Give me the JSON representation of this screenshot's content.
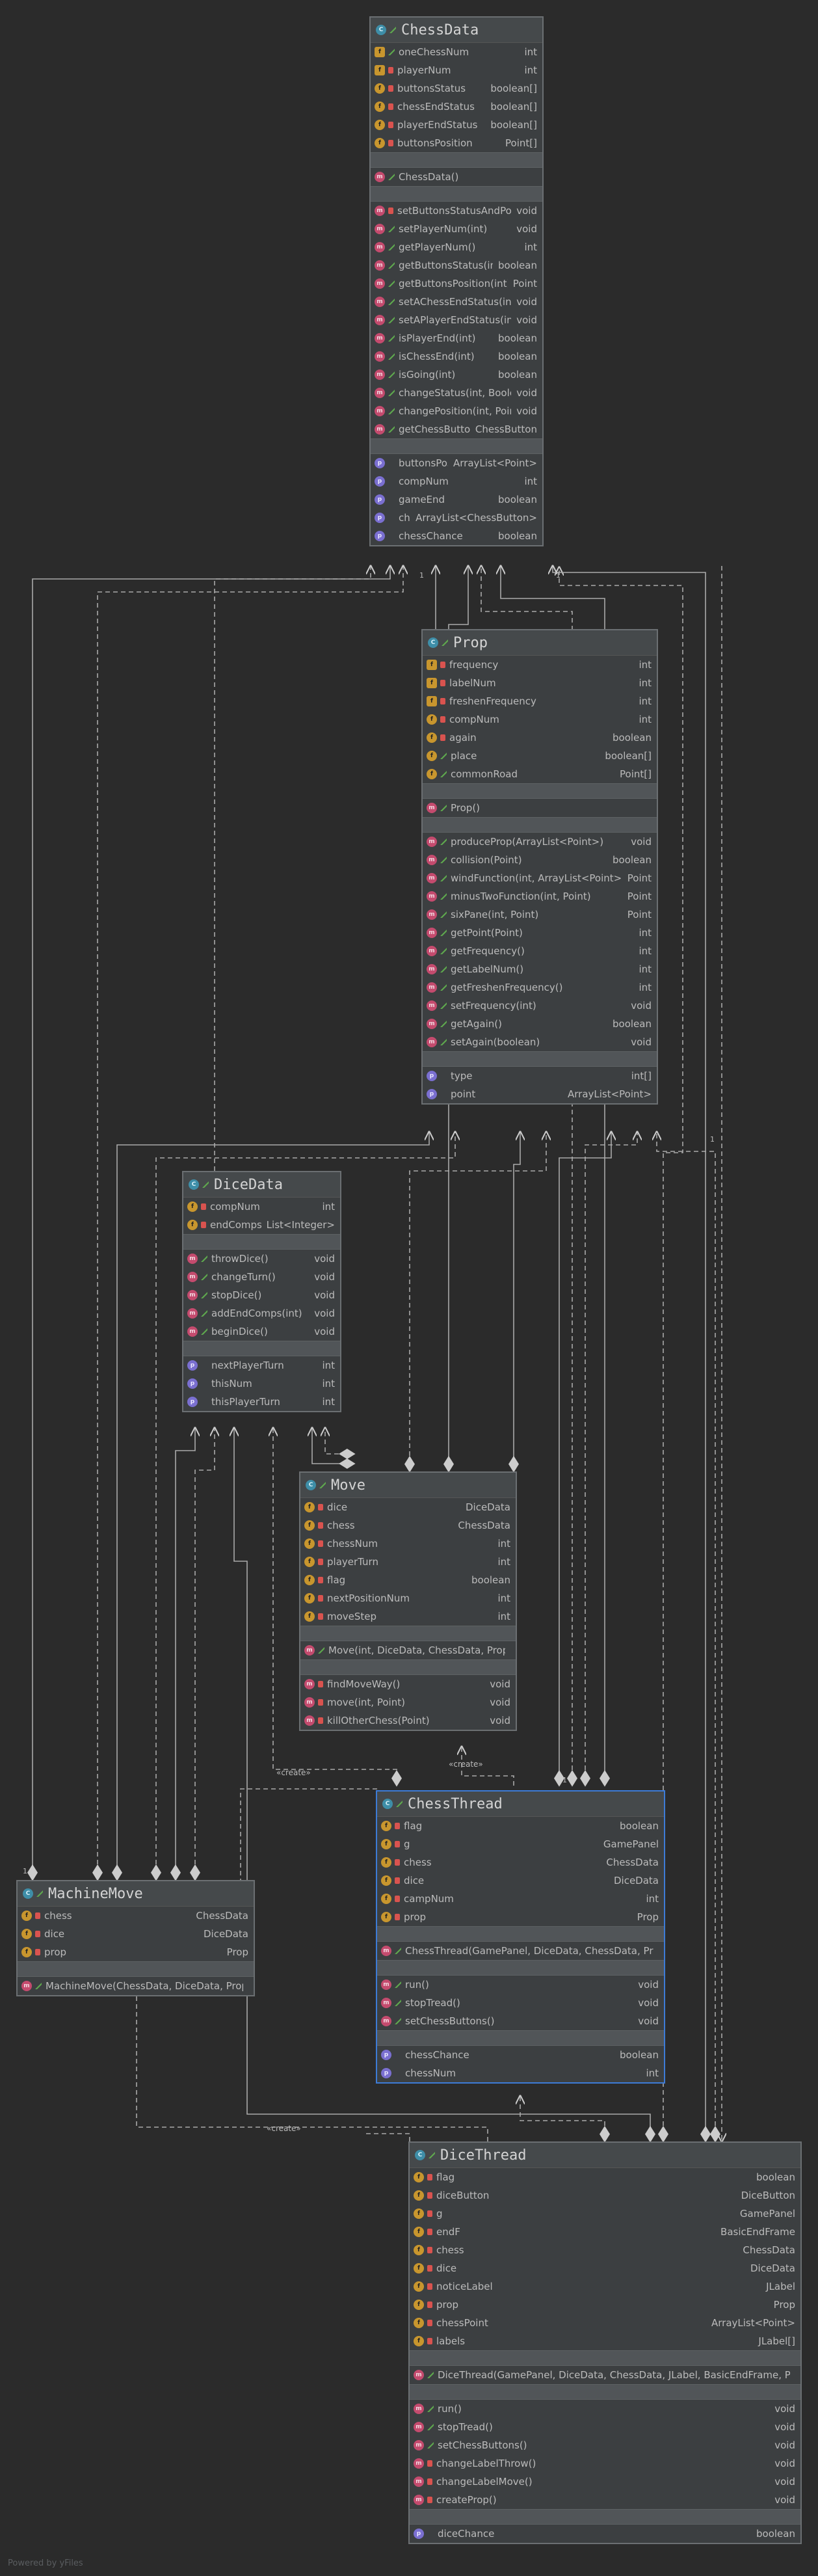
{
  "classes": [
    {
      "id": "chessdata",
      "title": "ChessData",
      "fields": [
        {
          "n": "oneChessNum",
          "t": "int",
          "icon": "fs",
          "vis": "pub"
        },
        {
          "n": "playerNum",
          "t": "int",
          "icon": "fs",
          "vis": "pri"
        },
        {
          "n": "buttonsStatus",
          "t": "boolean[]",
          "icon": "f",
          "vis": "pri"
        },
        {
          "n": "chessEndStatus",
          "t": "boolean[]",
          "icon": "f",
          "vis": "pri"
        },
        {
          "n": "playerEndStatus",
          "t": "boolean[]",
          "icon": "f",
          "vis": "pri"
        },
        {
          "n": "buttonsPosition",
          "t": "Point[]",
          "icon": "f",
          "vis": "pri"
        }
      ],
      "ctors": [
        {
          "n": "ChessData()",
          "t": "",
          "icon": "m",
          "vis": "pub"
        }
      ],
      "methods": [
        {
          "n": "setButtonsStatusAndPosition()",
          "t": "void",
          "icon": "m",
          "vis": "pri"
        },
        {
          "n": "setPlayerNum(int)",
          "t": "void",
          "icon": "m",
          "vis": "pub"
        },
        {
          "n": "getPlayerNum()",
          "t": "int",
          "icon": "m",
          "vis": "pub"
        },
        {
          "n": "getButtonsStatus(int)",
          "t": "boolean",
          "icon": "m",
          "vis": "pub"
        },
        {
          "n": "getButtonsPosition(int)",
          "t": "Point",
          "icon": "m",
          "vis": "pub"
        },
        {
          "n": "setAChessEndStatus(int, boolean)",
          "t": "void",
          "icon": "m",
          "vis": "pub"
        },
        {
          "n": "setAPlayerEndStatus(int, boolean)",
          "t": "void",
          "icon": "m",
          "vis": "pub"
        },
        {
          "n": "isPlayerEnd(int)",
          "t": "boolean",
          "icon": "m",
          "vis": "pub"
        },
        {
          "n": "isChessEnd(int)",
          "t": "boolean",
          "icon": "m",
          "vis": "pub"
        },
        {
          "n": "isGoing(int)",
          "t": "boolean",
          "icon": "m",
          "vis": "pub"
        },
        {
          "n": "changeStatus(int, Boolean)",
          "t": "void",
          "icon": "m",
          "vis": "pub"
        },
        {
          "n": "changePosition(int, Point)",
          "t": "void",
          "icon": "m",
          "vis": "pub"
        },
        {
          "n": "getChessButton(int)",
          "t": "ChessButton",
          "icon": "m",
          "vis": "pub"
        }
      ],
      "props": [
        {
          "n": "buttonsPosition",
          "t": "ArrayList<Point>",
          "icon": "p",
          "vis": "none"
        },
        {
          "n": "compNum",
          "t": "int",
          "icon": "p",
          "vis": "none"
        },
        {
          "n": "gameEnd",
          "t": "boolean",
          "icon": "p",
          "vis": "none"
        },
        {
          "n": "chessButtons",
          "t": "ArrayList<ChessButton>",
          "icon": "p",
          "vis": "none"
        },
        {
          "n": "chessChance",
          "t": "boolean",
          "icon": "p",
          "vis": "none"
        }
      ]
    },
    {
      "id": "prop",
      "title": "Prop",
      "fields": [
        {
          "n": "frequency",
          "t": "int",
          "icon": "fs",
          "vis": "pri"
        },
        {
          "n": "labelNum",
          "t": "int",
          "icon": "fs",
          "vis": "pri"
        },
        {
          "n": "freshenFrequency",
          "t": "int",
          "icon": "fs",
          "vis": "pri"
        },
        {
          "n": "compNum",
          "t": "int",
          "icon": "f",
          "vis": "pri"
        },
        {
          "n": "again",
          "t": "boolean",
          "icon": "f",
          "vis": "pri"
        },
        {
          "n": "place",
          "t": "boolean[]",
          "icon": "f",
          "vis": "pub"
        },
        {
          "n": "commonRoad",
          "t": "Point[]",
          "icon": "f",
          "vis": "pub"
        }
      ],
      "ctors": [
        {
          "n": "Prop()",
          "t": "",
          "icon": "m",
          "vis": "pub"
        }
      ],
      "methods": [
        {
          "n": "produceProp(ArrayList<Point>)",
          "t": "void",
          "icon": "m",
          "vis": "pub"
        },
        {
          "n": "collision(Point)",
          "t": "boolean",
          "icon": "m",
          "vis": "pub"
        },
        {
          "n": "windFunction(int, ArrayList<Point>)",
          "t": "Point",
          "icon": "m",
          "vis": "pub"
        },
        {
          "n": "minusTwoFunction(int, Point)",
          "t": "Point",
          "icon": "m",
          "vis": "pub"
        },
        {
          "n": "sixPane(int, Point)",
          "t": "Point",
          "icon": "m",
          "vis": "pub"
        },
        {
          "n": "getPoint(Point)",
          "t": "int",
          "icon": "m",
          "vis": "pub"
        },
        {
          "n": "getFrequency()",
          "t": "int",
          "icon": "m",
          "vis": "pub"
        },
        {
          "n": "getLabelNum()",
          "t": "int",
          "icon": "m",
          "vis": "pub"
        },
        {
          "n": "getFreshenFrequency()",
          "t": "int",
          "icon": "m",
          "vis": "pub"
        },
        {
          "n": "setFrequency(int)",
          "t": "void",
          "icon": "m",
          "vis": "pub"
        },
        {
          "n": "getAgain()",
          "t": "boolean",
          "icon": "m",
          "vis": "pub"
        },
        {
          "n": "setAgain(boolean)",
          "t": "void",
          "icon": "m",
          "vis": "pub"
        }
      ],
      "props": [
        {
          "n": "type",
          "t": "int[]",
          "icon": "p",
          "vis": "none"
        },
        {
          "n": "point",
          "t": "ArrayList<Point>",
          "icon": "p",
          "vis": "none"
        }
      ]
    },
    {
      "id": "dicedata",
      "title": "DiceData",
      "fields": [
        {
          "n": "compNum",
          "t": "int",
          "icon": "f",
          "vis": "pri"
        },
        {
          "n": "endComps",
          "t": "List<Integer>",
          "icon": "f",
          "vis": "pri"
        }
      ],
      "ctors": [],
      "methods": [
        {
          "n": "throwDice()",
          "t": "void",
          "icon": "m",
          "vis": "pub"
        },
        {
          "n": "changeTurn()",
          "t": "void",
          "icon": "m",
          "vis": "pub"
        },
        {
          "n": "stopDice()",
          "t": "void",
          "icon": "m",
          "vis": "pub"
        },
        {
          "n": "addEndComps(int)",
          "t": "void",
          "icon": "m",
          "vis": "pub"
        },
        {
          "n": "beginDice()",
          "t": "void",
          "icon": "m",
          "vis": "pub"
        }
      ],
      "props": [
        {
          "n": "nextPlayerTurn",
          "t": "int",
          "icon": "p",
          "vis": "none"
        },
        {
          "n": "thisNum",
          "t": "int",
          "icon": "p",
          "vis": "none"
        },
        {
          "n": "thisPlayerTurn",
          "t": "int",
          "icon": "p",
          "vis": "none"
        }
      ]
    },
    {
      "id": "move",
      "title": "Move",
      "fields": [
        {
          "n": "dice",
          "t": "DiceData",
          "icon": "f",
          "vis": "pri"
        },
        {
          "n": "chess",
          "t": "ChessData",
          "icon": "f",
          "vis": "pri"
        },
        {
          "n": "chessNum",
          "t": "int",
          "icon": "f",
          "vis": "pri"
        },
        {
          "n": "playerTurn",
          "t": "int",
          "icon": "f",
          "vis": "pri"
        },
        {
          "n": "flag",
          "t": "boolean",
          "icon": "f",
          "vis": "pri"
        },
        {
          "n": "nextPositionNum",
          "t": "int",
          "icon": "f",
          "vis": "pri"
        },
        {
          "n": "moveStep",
          "t": "int",
          "icon": "f",
          "vis": "pri"
        }
      ],
      "ctors": [
        {
          "n": "Move(int, DiceData, ChessData, Prop)",
          "t": "",
          "icon": "m",
          "vis": "pub"
        }
      ],
      "methods": [
        {
          "n": "findMoveWay()",
          "t": "void",
          "icon": "m",
          "vis": "pri"
        },
        {
          "n": "move(int, Point)",
          "t": "void",
          "icon": "m",
          "vis": "pri"
        },
        {
          "n": "killOtherChess(Point)",
          "t": "void",
          "icon": "m",
          "vis": "pri"
        }
      ],
      "props": []
    },
    {
      "id": "chessthread",
      "title": "ChessThread",
      "fields": [
        {
          "n": "flag",
          "t": "boolean",
          "icon": "f",
          "vis": "pri"
        },
        {
          "n": "g",
          "t": "GamePanel",
          "icon": "f",
          "vis": "pri"
        },
        {
          "n": "chess",
          "t": "ChessData",
          "icon": "f",
          "vis": "pri"
        },
        {
          "n": "dice",
          "t": "DiceData",
          "icon": "f",
          "vis": "pri"
        },
        {
          "n": "campNum",
          "t": "int",
          "icon": "f",
          "vis": "pri"
        },
        {
          "n": "prop",
          "t": "Prop",
          "icon": "f",
          "vis": "pri"
        }
      ],
      "ctors": [
        {
          "n": "ChessThread(GamePanel, DiceData, ChessData, Prop)",
          "t": "",
          "icon": "m",
          "vis": "pub"
        }
      ],
      "methods": [
        {
          "n": "run()",
          "t": "void",
          "icon": "m",
          "vis": "pub"
        },
        {
          "n": "stopTread()",
          "t": "void",
          "icon": "m",
          "vis": "pub"
        },
        {
          "n": "setChessButtons()",
          "t": "void",
          "icon": "m",
          "vis": "pub"
        }
      ],
      "props": [
        {
          "n": "chessChance",
          "t": "boolean",
          "icon": "p",
          "vis": "none"
        },
        {
          "n": "chessNum",
          "t": "int",
          "icon": "p",
          "vis": "none"
        }
      ]
    },
    {
      "id": "machinemove",
      "title": "MachineMove",
      "fields": [
        {
          "n": "chess",
          "t": "ChessData",
          "icon": "f",
          "vis": "pri"
        },
        {
          "n": "dice",
          "t": "DiceData",
          "icon": "f",
          "vis": "pri"
        },
        {
          "n": "prop",
          "t": "Prop",
          "icon": "f",
          "vis": "pri"
        }
      ],
      "ctors": [],
      "methods": [
        {
          "n": "MachineMove(ChessData, DiceData, Prop)",
          "t": "",
          "icon": "m",
          "vis": "pub"
        }
      ],
      "props": []
    },
    {
      "id": "dicethread",
      "title": "DiceThread",
      "fields": [
        {
          "n": "flag",
          "t": "boolean",
          "icon": "f",
          "vis": "pri"
        },
        {
          "n": "diceButton",
          "t": "DiceButton",
          "icon": "f",
          "vis": "pri"
        },
        {
          "n": "g",
          "t": "GamePanel",
          "icon": "f",
          "vis": "pri"
        },
        {
          "n": "endF",
          "t": "BasicEndFrame",
          "icon": "f",
          "vis": "pri"
        },
        {
          "n": "chess",
          "t": "ChessData",
          "icon": "f",
          "vis": "pri"
        },
        {
          "n": "dice",
          "t": "DiceData",
          "icon": "f",
          "vis": "pri"
        },
        {
          "n": "noticeLabel",
          "t": "JLabel",
          "icon": "f",
          "vis": "pri"
        },
        {
          "n": "prop",
          "t": "Prop",
          "icon": "f",
          "vis": "pri"
        },
        {
          "n": "chessPoint",
          "t": "ArrayList<Point>",
          "icon": "f",
          "vis": "pri"
        },
        {
          "n": "labels",
          "t": "JLabel[]",
          "icon": "f",
          "vis": "pri"
        }
      ],
      "ctors": [
        {
          "n": "DiceThread(GamePanel, DiceData, ChessData, JLabel, BasicEndFrame, Prop)",
          "t": "",
          "icon": "m",
          "vis": "pub"
        }
      ],
      "methods": [
        {
          "n": "run()",
          "t": "void",
          "icon": "m",
          "vis": "pub"
        },
        {
          "n": "stopTread()",
          "t": "void",
          "icon": "m",
          "vis": "pub"
        },
        {
          "n": "setChessButtons()",
          "t": "void",
          "icon": "m",
          "vis": "pub"
        },
        {
          "n": "changeLabelThrow()",
          "t": "void",
          "icon": "m",
          "vis": "pri"
        },
        {
          "n": "changeLabelMove()",
          "t": "void",
          "icon": "m",
          "vis": "pri"
        },
        {
          "n": "createProp()",
          "t": "void",
          "icon": "m",
          "vis": "pri"
        }
      ],
      "props": [
        {
          "n": "diceChance",
          "t": "boolean",
          "icon": "p",
          "vis": "none"
        }
      ]
    }
  ],
  "labels": {
    "create1": "«create»",
    "create2": "«create»",
    "create3": "«create»"
  },
  "mult": {
    "one": "1"
  },
  "footer": "Powered by yFiles",
  "colors": {
    "background": "#2b2b2b",
    "node": "#3c3f41",
    "edge": "#aaaaaa",
    "selection": "#3d7bd6"
  }
}
